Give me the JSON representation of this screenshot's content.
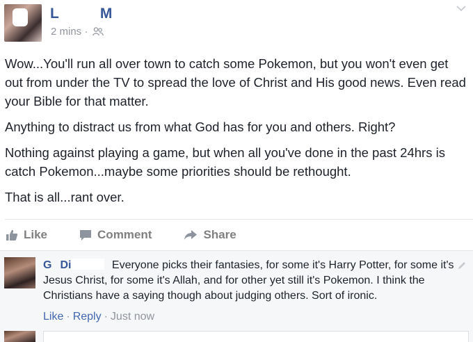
{
  "post": {
    "author_first": "L",
    "author_last": "M",
    "time": "2 mins",
    "separator": "·",
    "audience_icon": "friends-icon",
    "paragraphs": [
      "Wow...You'll run all over town to catch some Pokemon, but you won't even get out from under the TV to spread the love of Christ and His good news. Even read your Bible for that matter.",
      "Anything to distract us from what God has for you and others. Right?",
      "Nothing against playing a game, but when all you've done in the past 24hrs is catch Pokemon...maybe some priorities should be rethought.",
      "That is all...rant over."
    ]
  },
  "actions": {
    "like": "Like",
    "comment": "Comment",
    "share": "Share"
  },
  "comment": {
    "author_first": "G",
    "author_last": "Di",
    "text": "Everyone picks their fantasies, for some it's Harry Potter, for some it's Jesus Christ, for some it's Allah, and for other yet still it's Pokemon. I think the Christians have a saying though about judging others. Sort of ironic.",
    "like": "Like",
    "reply": "Reply",
    "time": "Just now",
    "separator": "·"
  },
  "colors": {
    "link": "#365899",
    "meta": "#90949c",
    "action": "#7f7f7f",
    "comment_bg": "#f6f7f9"
  }
}
